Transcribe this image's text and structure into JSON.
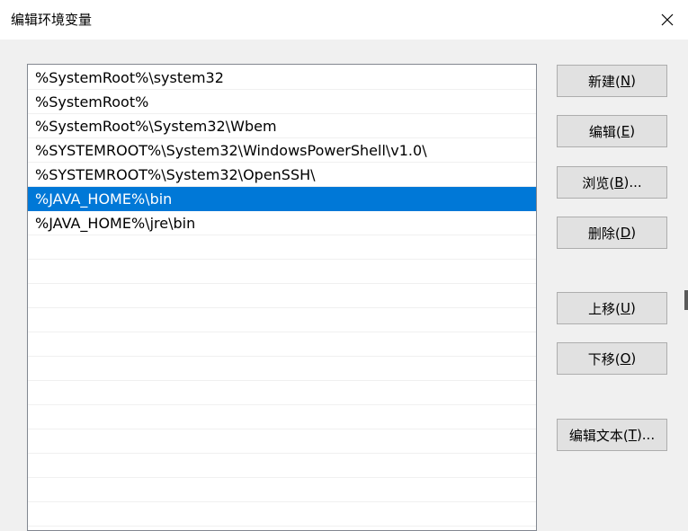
{
  "dialog": {
    "title": "编辑环境变量",
    "close_symbol": "✕"
  },
  "list": {
    "selected_index": 5,
    "items": [
      "%SystemRoot%\\system32",
      "%SystemRoot%",
      "%SystemRoot%\\System32\\Wbem",
      "%SYSTEMROOT%\\System32\\WindowsPowerShell\\v1.0\\",
      "%SYSTEMROOT%\\System32\\OpenSSH\\",
      "%JAVA_HOME%\\bin",
      "%JAVA_HOME%\\jre\\bin",
      "",
      "",
      "",
      "",
      "",
      "",
      "",
      "",
      "",
      "",
      "",
      ""
    ]
  },
  "buttons": {
    "new": {
      "text": "新建(",
      "key": "N",
      "suffix": ")"
    },
    "edit": {
      "text": "编辑(",
      "key": "E",
      "suffix": ")"
    },
    "browse": {
      "text": "浏览(",
      "key": "B",
      "suffix": ")..."
    },
    "delete": {
      "text": "删除(",
      "key": "D",
      "suffix": ")"
    },
    "move_up": {
      "text": "上移(",
      "key": "U",
      "suffix": ")"
    },
    "move_down": {
      "text": "下移(",
      "key": "O",
      "suffix": ")"
    },
    "edit_text": {
      "text": "编辑文本(",
      "key": "T",
      "suffix": ")..."
    }
  },
  "colors": {
    "selection": "#0078d7",
    "window_bg": "#f0f0f0",
    "button_bg": "#e1e1e1"
  }
}
